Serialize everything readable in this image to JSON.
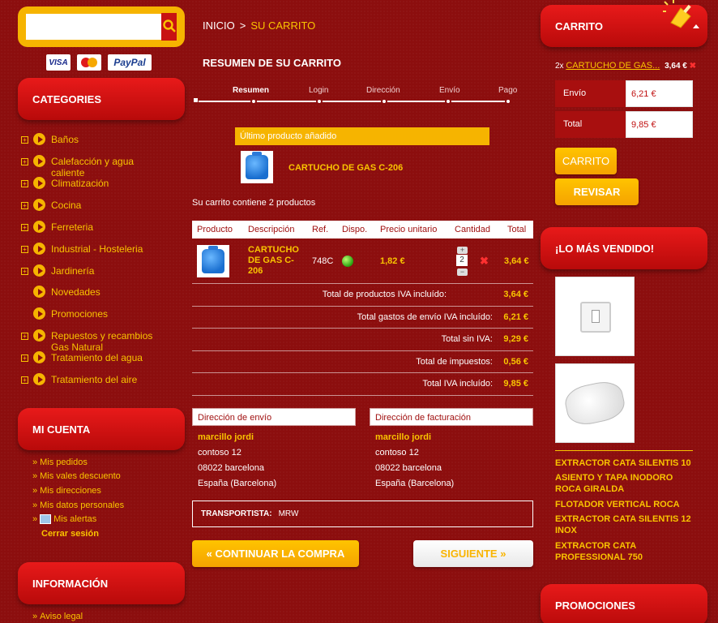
{
  "search": {
    "placeholder": "",
    "value": ""
  },
  "payment_cards": [
    "VISA",
    "MasterCard",
    "PayPal"
  ],
  "categories": {
    "title": "CATEGORIES",
    "items": [
      {
        "label": "Baños",
        "expandable": true
      },
      {
        "label": "Calefacción y agua caliente",
        "expandable": true
      },
      {
        "label": "Climatización",
        "expandable": true
      },
      {
        "label": "Cocina",
        "expandable": true
      },
      {
        "label": "Ferreteria",
        "expandable": true
      },
      {
        "label": "Industrial - Hosteleria",
        "expandable": true
      },
      {
        "label": "Jardinería",
        "expandable": true
      },
      {
        "label": "Novedades",
        "expandable": false
      },
      {
        "label": "Promociones",
        "expandable": false
      },
      {
        "label": "Repuestos y recambios Gas Natural",
        "expandable": true
      },
      {
        "label": "Tratamiento del agua",
        "expandable": true
      },
      {
        "label": "Tratamiento del aire",
        "expandable": true
      }
    ]
  },
  "account": {
    "title": "MI CUENTA",
    "links": [
      "Mis pedidos",
      "Mis vales descuento",
      "Mis direcciones",
      "Mis datos personales",
      "Mis alertas"
    ],
    "logout": "Cerrar sesión"
  },
  "info": {
    "title": "INFORMACIÓN",
    "links": [
      "Aviso legal"
    ]
  },
  "breadcrumb": {
    "home": "INICIO",
    "separator": ">",
    "current": "SU CARRITO"
  },
  "page_title": "RESUMEN DE SU CARRITO",
  "steps": [
    "Resumen",
    "Login",
    "Dirección",
    "Envío",
    "Pago"
  ],
  "last_added": {
    "header": "Último producto añadido",
    "product": "CARTUCHO DE GAS C-206"
  },
  "cart_count_text": "Su carrito contiene 2 productos",
  "table": {
    "headers": [
      "Producto",
      "Descripción",
      "Ref.",
      "Dispo.",
      "Precio unitario",
      "Cantidad",
      "Total"
    ],
    "rows": [
      {
        "description": "CARTUCHO DE GAS C-206",
        "ref": "748C",
        "unit_price": "1,82 €",
        "quantity": "2",
        "total": "3,64 €"
      }
    ],
    "totals": [
      {
        "label": "Total de productos IVA incluído:",
        "value": "3,64 €"
      },
      {
        "label": "Total gastos de envío IVA incluído:",
        "value": "6,21 €"
      },
      {
        "label": "Total sin IVA:",
        "value": "9,29 €"
      },
      {
        "label": "Total de impuestos:",
        "value": "0,56 €"
      },
      {
        "label": "Total IVA incluído:",
        "value": "9,85 €"
      }
    ]
  },
  "shipping_address": {
    "title": "Dirección de envío",
    "name": "marcillo jordi",
    "street": "contoso 12",
    "city": "08022 barcelona",
    "region": "España (Barcelona)"
  },
  "billing_address": {
    "title": "Dirección de facturación",
    "name": "marcillo jordi",
    "street": "contoso 12",
    "city": "08022 barcelona",
    "region": "España (Barcelona)"
  },
  "carrier": {
    "label": "TRANSPORTISTA:",
    "value": "MRW"
  },
  "buttons": {
    "continue": "« CONTINUAR LA COMPRA",
    "next": "SIGUIENTE »"
  },
  "mini_cart": {
    "title": "CARRITO",
    "item_qty": "2x",
    "item_name": "CARTUCHO DE GAS...",
    "item_price": "3,64 €",
    "shipping_label": "Envío",
    "shipping_value": "6,21 €",
    "total_label": "Total",
    "total_value": "9,85 €",
    "cart_button": "CARRITO",
    "review_button": "REVISAR"
  },
  "bestsellers": {
    "title": "¡LO MÁS VENDIDO!",
    "items": [
      "EXTRACTOR CATA SILENTIS 10",
      "ASIENTO Y TAPA INODORO ROCA GIRALDA",
      "FLOTADOR VERTICAL ROCA",
      "EXTRACTOR CATA SILENTIS 12 INOX",
      "EXTRACTOR CATA PROFESSIONAL 750"
    ]
  },
  "promotions": {
    "title": "PROMOCIONES"
  },
  "colors": {
    "background": "#8c0e0e",
    "accent": "#f9c400",
    "header_red": "#d81414",
    "button_yellow": "#f5a300"
  }
}
